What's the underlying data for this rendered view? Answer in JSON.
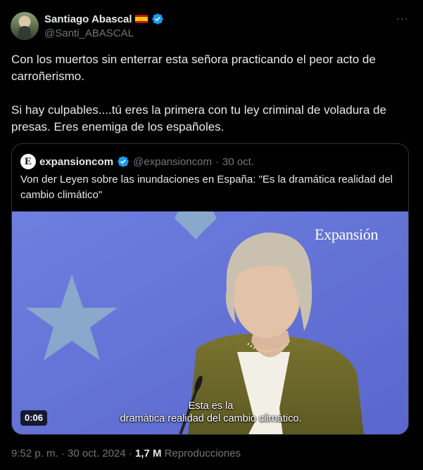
{
  "author": {
    "name": "Santiago Abascal",
    "handle": "@Santi_ABASCAL",
    "flag_icon": "spain-flag-icon",
    "verified_icon": "verified-badge-icon"
  },
  "tweet": {
    "paragraphs": [
      "Con los muertos sin enterrar esta señora practicando el peor acto de carroñerismo.",
      "Si hay culpables....tú eres la primera con tu ley criminal de voladura de presas. Eres enemiga de los españoles."
    ]
  },
  "quoted": {
    "logo_letter": "E",
    "name": "expansioncom",
    "handle": "@expansioncom",
    "separator": "·",
    "date": "30 oct.",
    "text": "Von der Leyen sobre las inundaciones en España: \"Es la dramática realidad del cambio climático\"",
    "media": {
      "brand": "Expansión",
      "subtitle_line1": "Esta es la",
      "subtitle_line2": "dramática realidad del cambio climático.",
      "duration": "0:06"
    }
  },
  "meta": {
    "time": "9:52 p. m.",
    "sep1": "·",
    "date": "30 oct. 2024",
    "sep2": "·",
    "views_count": "1,7 M",
    "views_label": "Reproducciones"
  },
  "colors": {
    "background": "#000000",
    "text": "#e7e9ea",
    "muted": "#71767b",
    "verified": "#1d9bf0",
    "video_blue": "#6a78db"
  }
}
